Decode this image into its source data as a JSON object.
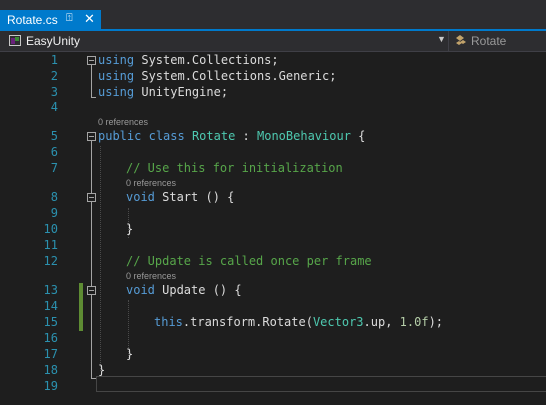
{
  "tab": {
    "title": "Rotate.cs",
    "pin_glyph": "⍐",
    "close_glyph": "✕"
  },
  "navbar": {
    "project": "EasyUnity",
    "member": "Rotate",
    "project_icon": "csharp-project-icon",
    "member_icon": "class-icon"
  },
  "codelens": {
    "l5": "0 references",
    "l8": "0 references",
    "l13": "0 references"
  },
  "line_numbers": [
    "1",
    "2",
    "3",
    "4",
    "5",
    "6",
    "7",
    "8",
    "9",
    "10",
    "11",
    "12",
    "13",
    "14",
    "15",
    "16",
    "17",
    "18",
    "19"
  ],
  "code": {
    "l1_kw": "using",
    "l1_rest": " System.Collections;",
    "l2_kw": "using",
    "l2_rest": " System.Collections.Generic;",
    "l3_kw": "using",
    "l3_rest": " UnityEngine;",
    "l5_kw1": "public",
    "l5_kw2": "class",
    "l5_name": "Rotate",
    "l5_colon": " : ",
    "l5_base": "MonoBehaviour",
    "l5_brace": " {",
    "l7_comment": "// Use this for initialization",
    "l8_kw": "void",
    "l8_rest": " Start () {",
    "l10": "}",
    "l12_comment": "// Update is called once per frame",
    "l13_kw": "void",
    "l13_rest": " Update () {",
    "l15_kw": "this",
    "l15_mid": ".transform.Rotate(",
    "l15_type": "Vector3",
    "l15_up": ".up, ",
    "l15_num": "1.0f",
    "l15_end": ");",
    "l17": "}",
    "l18": "}"
  },
  "colors": {
    "accent": "#007acc",
    "keyword": "#569cd6",
    "type": "#4ec9b0",
    "comment": "#57a64a",
    "number": "#b5cea8",
    "line_number": "#2b91af",
    "change_bar": "#5e8c33"
  }
}
